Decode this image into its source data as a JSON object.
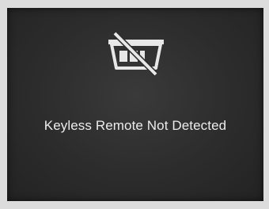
{
  "display": {
    "icon": "keyless-remote-not-detected-icon",
    "message": "Keyless Remote Not Detected"
  }
}
